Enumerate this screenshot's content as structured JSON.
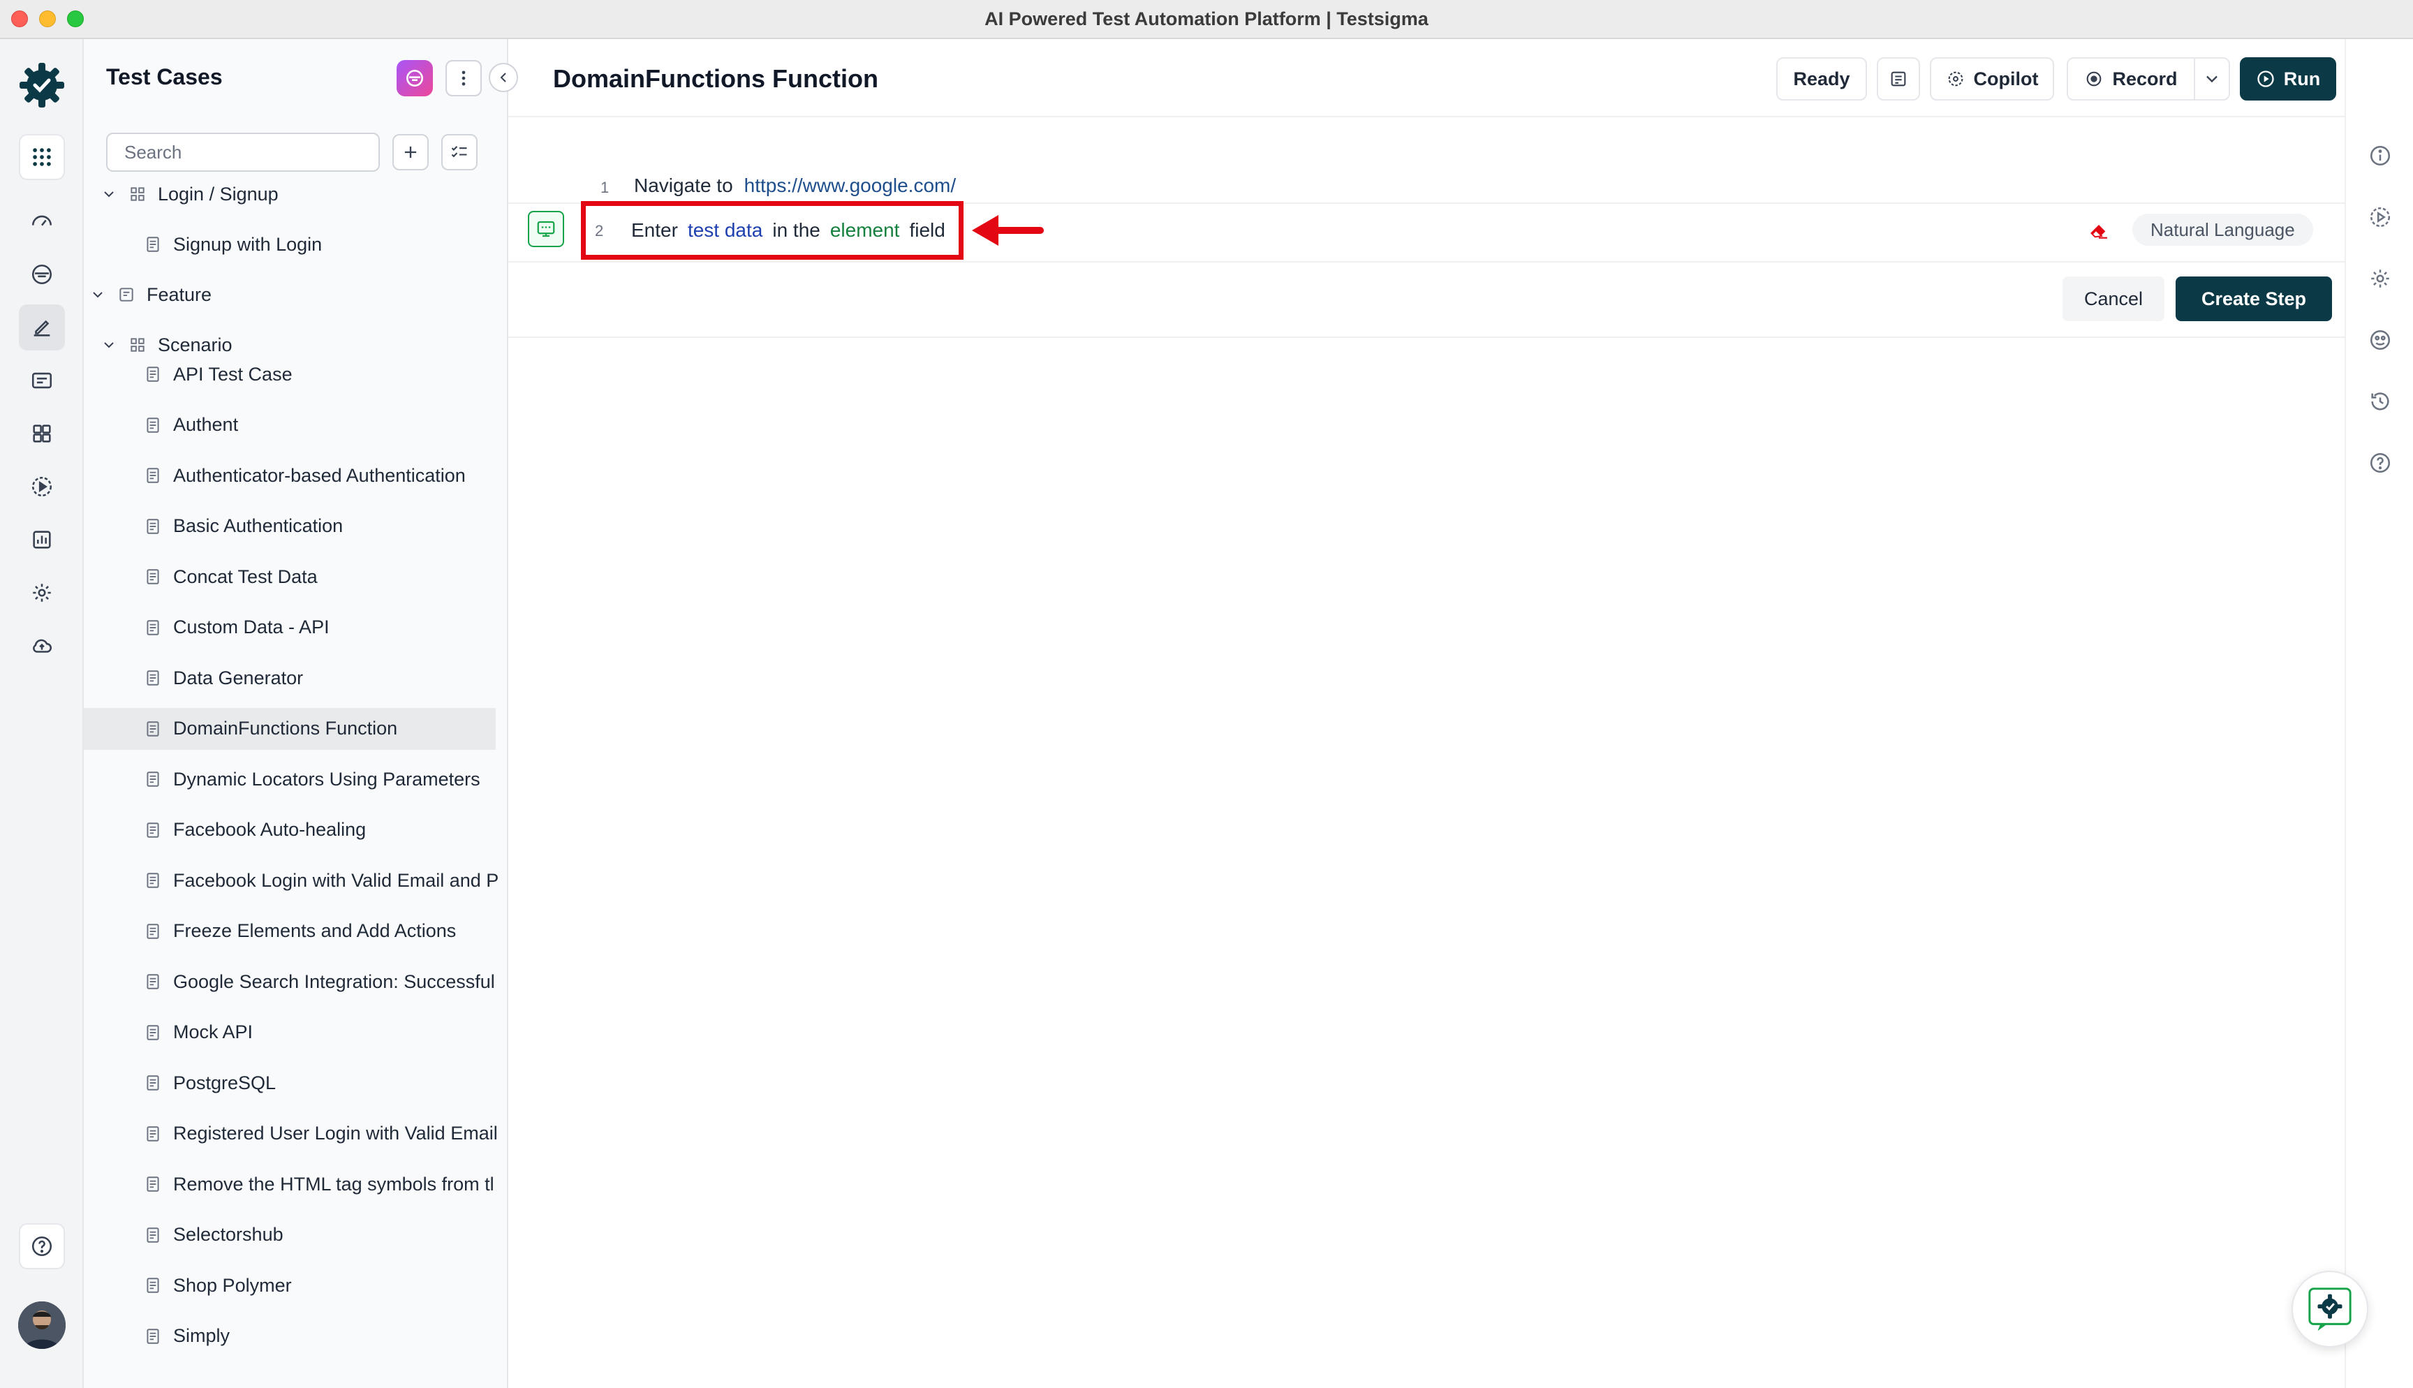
{
  "window": {
    "title": "AI Powered Test Automation Platform | Testsigma"
  },
  "rail": {
    "icons": [
      "logo-icon",
      "apps-grid-icon",
      "dashboard-icon",
      "copilot-icon",
      "test-cases-icon",
      "folder-icon",
      "modules-icon",
      "runs-icon",
      "reports-icon",
      "settings-icon",
      "cloud-icon",
      "help-icon",
      "avatar"
    ]
  },
  "tree": {
    "title": "Test Cases",
    "search_placeholder": "Search",
    "items": [
      {
        "label": "Login / Signup",
        "kind": "scenario"
      },
      {
        "label": "Signup with Login",
        "kind": "case"
      },
      {
        "label": "Feature",
        "kind": "feature"
      },
      {
        "label": "Scenario",
        "kind": "scenario"
      },
      {
        "label": "API Test Case",
        "kind": "case"
      },
      {
        "label": "Authent",
        "kind": "case"
      },
      {
        "label": "Authenticator-based Authentication",
        "kind": "case"
      },
      {
        "label": "Basic Authentication",
        "kind": "case"
      },
      {
        "label": "Concat Test Data",
        "kind": "case"
      },
      {
        "label": "Custom Data - API",
        "kind": "case"
      },
      {
        "label": "Data Generator",
        "kind": "case"
      },
      {
        "label": "DomainFunctions Function",
        "kind": "case"
      },
      {
        "label": "Dynamic Locators Using Parameters",
        "kind": "case"
      },
      {
        "label": "Facebook Auto-healing",
        "kind": "case"
      },
      {
        "label": "Facebook Login with Valid Email and P",
        "kind": "case"
      },
      {
        "label": "Freeze Elements and Add Actions",
        "kind": "case"
      },
      {
        "label": "Google Search Integration: Successful",
        "kind": "case"
      },
      {
        "label": "Mock API",
        "kind": "case"
      },
      {
        "label": "PostgreSQL",
        "kind": "case"
      },
      {
        "label": "Registered User Login with Valid Email",
        "kind": "case"
      },
      {
        "label": "Remove the HTML tag symbols from tl",
        "kind": "case"
      },
      {
        "label": "Selectorshub",
        "kind": "case"
      },
      {
        "label": "Shop Polymer",
        "kind": "case"
      },
      {
        "label": "Simply",
        "kind": "case"
      }
    ]
  },
  "main": {
    "title": "DomainFunctions Function",
    "status": "Ready",
    "copilot_label": "Copilot",
    "record_label": "Record",
    "run_label": "Run",
    "steps": [
      {
        "num": "1",
        "parts": {
          "t1": "Navigate to",
          "url": "https://www.google.com/"
        }
      },
      {
        "num": "2",
        "parts": {
          "t1": "Enter",
          "data": "test data",
          "t2": "in the",
          "element": "element",
          "t3": "field"
        }
      }
    ],
    "language_badge": "Natural Language",
    "cancel_label": "Cancel",
    "create_label": "Create Step"
  },
  "colors": {
    "primary": "#0b3a46",
    "highlight": "#e30613",
    "element_token": "#15803d",
    "data_token": "#1e40af"
  }
}
